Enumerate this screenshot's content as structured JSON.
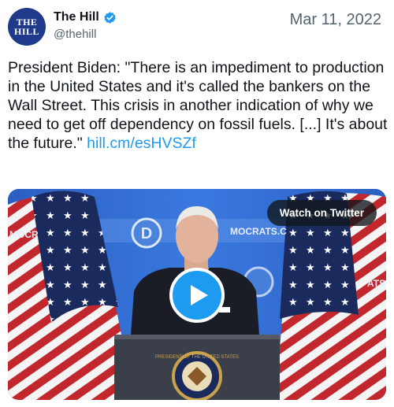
{
  "header": {
    "avatar_line1": "THE",
    "avatar_line2": "HILL",
    "display_name": "The Hill",
    "handle": "@thehill",
    "date": "Mar 11, 2022"
  },
  "tweet": {
    "text": "President Biden: \"There is an impediment to production in the United States and it's called the bankers on the Wall Street. This crisis in another indication of why we need to get off dependency on fossil fuels. [...] It's about the future.\" ",
    "link": "hill.cm/esHVSZf"
  },
  "media": {
    "watch_label": "Watch on Twitter",
    "banner_text_left": "MOCR",
    "banner_text_center": "MOCRATS.C",
    "banner_text_right": "ATS.",
    "seal_text": "PRESIDENT OF THE UNITED STATES"
  },
  "colors": {
    "accent": "#1d9bf0",
    "avatar_bg": "#1f3a8a"
  }
}
